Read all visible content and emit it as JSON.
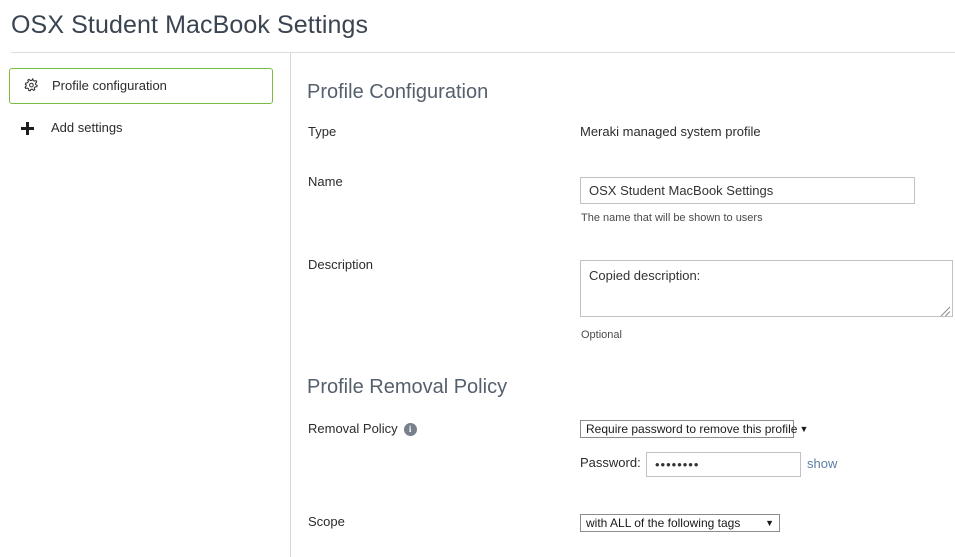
{
  "header": {
    "title": "OSX Student MacBook Settings"
  },
  "sidebar": {
    "items": [
      {
        "label": "Profile configuration",
        "icon": "gear-icon",
        "selected": true
      }
    ],
    "add_settings_label": "Add settings",
    "add_icon": "plus-icon",
    "selected_border_color": "#7bbd42"
  },
  "main": {
    "section_profile_configuration": {
      "heading": "Profile Configuration",
      "type_label": "Type",
      "type_value": "Meraki managed system profile",
      "name_label": "Name",
      "name_value": "OSX Student MacBook Settings",
      "name_helper": "The name that will be shown to users",
      "description_label": "Description",
      "description_value": "Copied description:",
      "description_helper": "Optional"
    },
    "section_profile_removal_policy": {
      "heading": "Profile Removal Policy",
      "removal_policy_label": "Removal Policy",
      "removal_policy_info_icon": "info-icon",
      "removal_policy_value": "Require password to remove this profile",
      "removal_policy_options": [
        "Require password to remove this profile"
      ],
      "password_label": "Password:",
      "password_value": "••••••••",
      "password_show_link": "show",
      "scope_label": "Scope",
      "scope_value": "with ALL of the following tags",
      "scope_options": [
        "with ALL of the following tags"
      ]
    }
  },
  "colors": {
    "accent_green": "#7bbd42",
    "link_blue": "#5b7fa6",
    "heading_gray": "#55606e"
  }
}
